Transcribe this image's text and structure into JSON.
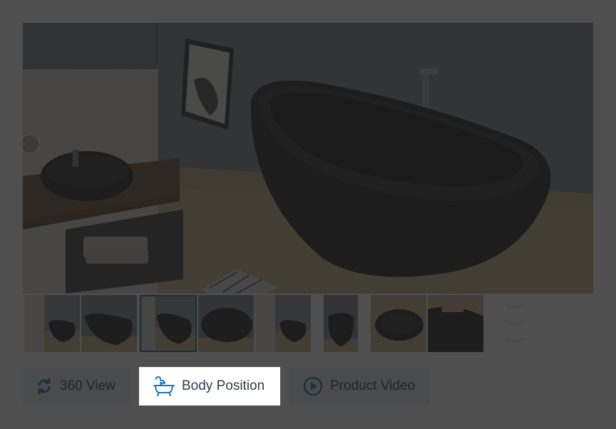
{
  "gallery": {
    "main_image": {
      "alt": "Freestanding bathtub in dark bathroom",
      "icon": "bathtub-photo"
    },
    "thumbnails": [
      {
        "name": "thumb-1",
        "selected": false
      },
      {
        "name": "thumb-2",
        "selected": false
      },
      {
        "name": "thumb-3",
        "selected": true
      },
      {
        "name": "thumb-4",
        "selected": false
      },
      {
        "name": "thumb-5",
        "selected": false
      },
      {
        "name": "thumb-6",
        "selected": false
      },
      {
        "name": "thumb-7",
        "selected": false
      },
      {
        "name": "thumb-8",
        "selected": false
      }
    ]
  },
  "buttons": {
    "view360": {
      "label": "360 View",
      "icon": "refresh-icon"
    },
    "body_position": {
      "label": "Body Position",
      "icon": "bathtub-icon"
    },
    "product_video": {
      "label": "Product Video",
      "icon": "play-circle-icon"
    }
  },
  "colors": {
    "accent": "#1a78c2",
    "selected_border": "#0d6b98",
    "overlay": "rgba(30,30,30,0.78)"
  }
}
